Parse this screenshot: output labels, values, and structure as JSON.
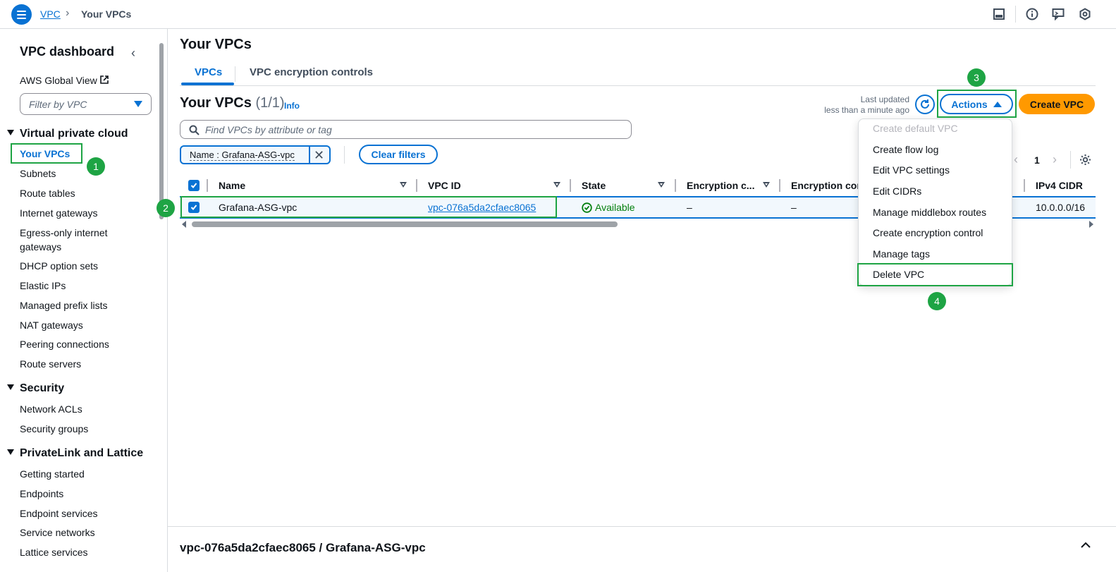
{
  "breadcrumb": {
    "root": "VPC",
    "current": "Your VPCs"
  },
  "sidebar": {
    "title": "VPC dashboard",
    "global_view": "AWS Global View",
    "filter_placeholder": "Filter by VPC",
    "sections": [
      {
        "title": "Virtual private cloud",
        "items": [
          "Your VPCs",
          "Subnets",
          "Route tables",
          "Internet gateways",
          "Egress-only internet gateways",
          "DHCP option sets",
          "Elastic IPs",
          "Managed prefix lists",
          "NAT gateways",
          "Peering connections",
          "Route servers"
        ]
      },
      {
        "title": "Security",
        "items": [
          "Network ACLs",
          "Security groups"
        ]
      },
      {
        "title": "PrivateLink and Lattice",
        "items": [
          "Getting started",
          "Endpoints",
          "Endpoint services",
          "Service networks",
          "Lattice services"
        ]
      }
    ]
  },
  "main": {
    "title": "Your VPCs",
    "tabs": [
      "VPCs",
      "VPC encryption controls"
    ],
    "table_title": "Your VPCs",
    "table_count": "(1/1)",
    "info": "Info",
    "last_updated_1": "Last updated",
    "last_updated_2": "less than a minute ago",
    "actions_label": "Actions",
    "create_label": "Create VPC",
    "search_placeholder": "Find VPCs by attribute or tag",
    "filter_token": "Name : Grafana-ASG-vpc",
    "clear_filters": "Clear filters",
    "page": "1",
    "columns": [
      "Name",
      "VPC ID",
      "State",
      "Encryption c...",
      "Encryption cor",
      "IPv4 CIDR"
    ],
    "row": {
      "name": "Grafana-ASG-vpc",
      "vpc_id": "vpc-076a5da2cfaec8065",
      "state": "Available",
      "enc1": "–",
      "enc2": "–",
      "cidr": "10.0.0.0/16"
    }
  },
  "actions_menu": [
    "Create default VPC",
    "Create flow log",
    "Edit VPC settings",
    "Edit CIDRs",
    "Manage middlebox routes",
    "Create encryption control",
    "Manage tags",
    "Delete VPC"
  ],
  "annotations": [
    "1",
    "2",
    "3",
    "4"
  ],
  "split_panel": {
    "title": "vpc-076a5da2cfaec8065 / Grafana-ASG-vpc"
  },
  "colors": {
    "accent": "#0972d3",
    "primary_button": "#ff9900",
    "highlight": "#1ea444",
    "success": "#037f0c"
  }
}
